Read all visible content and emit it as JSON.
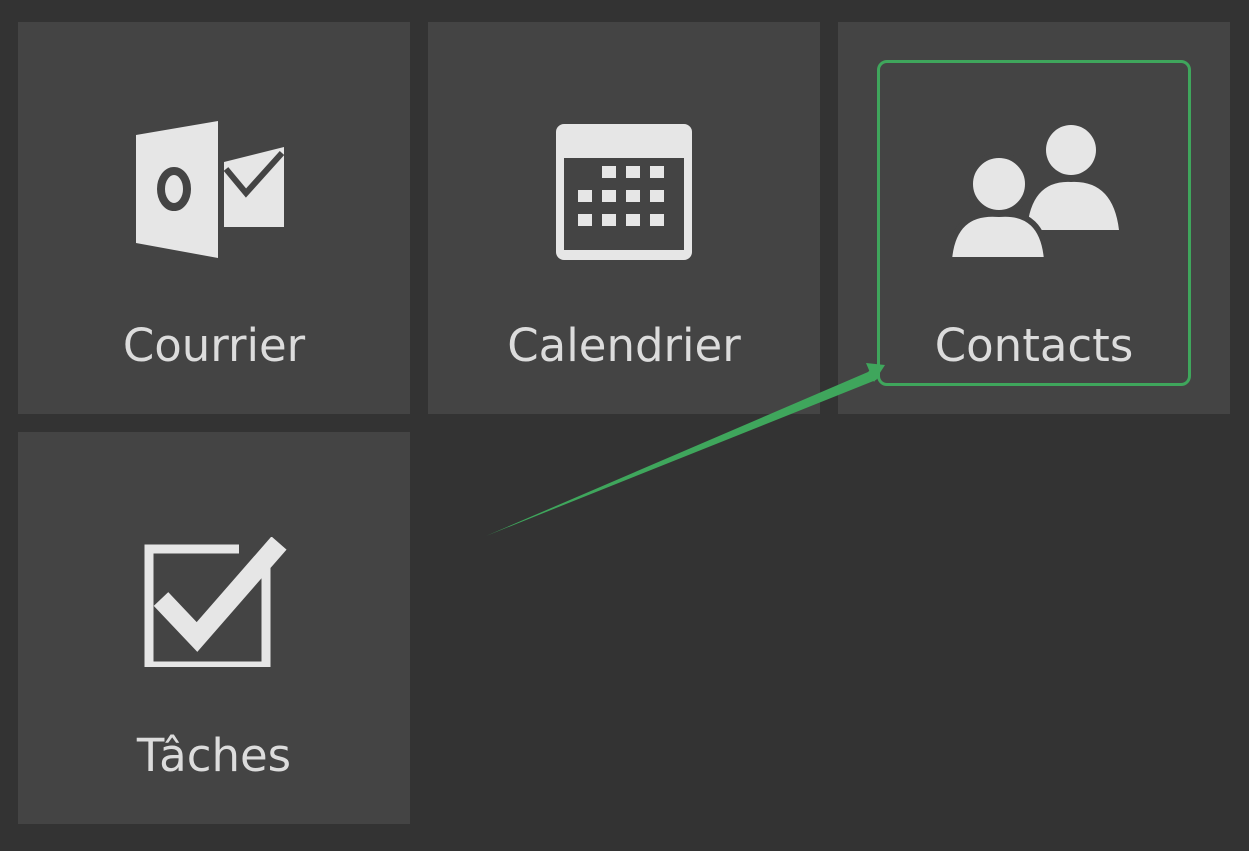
{
  "tiles": [
    {
      "id": "mail",
      "label": "Courrier",
      "icon": "outlook-mail-icon"
    },
    {
      "id": "calendar",
      "label": "Calendrier",
      "icon": "calendar-icon"
    },
    {
      "id": "contacts",
      "label": "Contacts",
      "icon": "contacts-people-icon",
      "highlighted": true
    },
    {
      "id": "tasks",
      "label": "Tâches",
      "icon": "checkbox-checked-icon"
    }
  ],
  "colors": {
    "background": "#333333",
    "tile": "#444444",
    "icon": "#e6e6e6",
    "label": "#dcdcdc",
    "highlight": "#3fa65c"
  }
}
